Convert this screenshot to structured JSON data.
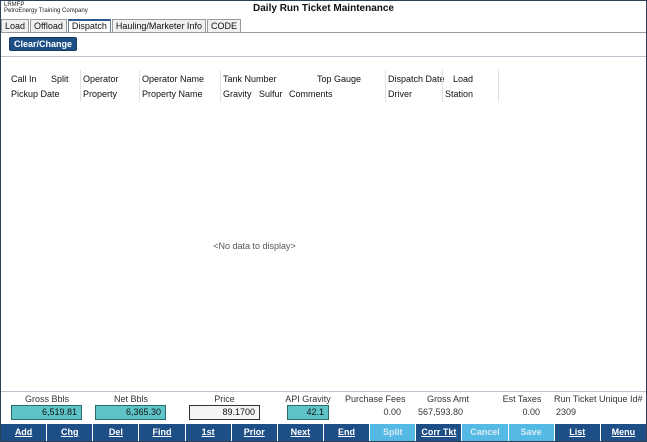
{
  "header": {
    "app_code": "LRMFP",
    "company": "PetroEnergy Training Company",
    "title": "Daily Run Ticket Maintenance"
  },
  "tabs": [
    {
      "label": "Load",
      "active": false
    },
    {
      "label": "Offload",
      "active": false
    },
    {
      "label": "Dispatch",
      "active": true
    },
    {
      "label": "Hauling/Marketer Info",
      "active": false
    },
    {
      "label": "CODE",
      "active": false
    }
  ],
  "toolbar": {
    "clear_change_label": "Clear/Change"
  },
  "grid": {
    "row1": [
      "Call In",
      "Split",
      "Operator",
      "Operator Name",
      "Tank Number",
      "Top Gauge",
      "Dispatch Date",
      "Load"
    ],
    "row2": [
      "Pickup Date",
      "Property",
      "Property Name",
      "Gravity",
      "Sulfur",
      "Comments",
      "Driver",
      "Station"
    ],
    "empty_message": "<No data to display>"
  },
  "totals": {
    "gross_bbls": {
      "label": "Gross Bbls",
      "value": "6,519.81"
    },
    "net_bbls": {
      "label": "Net Bbls",
      "value": "6,365.30"
    },
    "price": {
      "label": "Price",
      "value": "89.1700"
    },
    "api_gravity": {
      "label": "API Gravity",
      "value": "42.1"
    },
    "purchase_fees": {
      "label": "Purchase Fees",
      "value": "0.00"
    },
    "gross_amt": {
      "label": "Gross Amt",
      "value": "567,593.80"
    },
    "est_taxes": {
      "label": "Est Taxes",
      "value": "0.00"
    },
    "run_ticket_id": {
      "label": "Run Ticket Unique Id#",
      "value": "2309"
    }
  },
  "buttons": [
    {
      "label": "Add",
      "enabled": true
    },
    {
      "label": "Chg",
      "enabled": true
    },
    {
      "label": "Del",
      "enabled": true
    },
    {
      "label": "Find",
      "enabled": true
    },
    {
      "label": "1st",
      "enabled": true
    },
    {
      "label": "Prior",
      "enabled": true
    },
    {
      "label": "Next",
      "enabled": true
    },
    {
      "label": "End",
      "enabled": true
    },
    {
      "label": "Split",
      "enabled": false
    },
    {
      "label": "Corr Tkt",
      "enabled": true
    },
    {
      "label": "Cancel",
      "enabled": false
    },
    {
      "label": "Save",
      "enabled": false
    },
    {
      "label": "List",
      "enabled": true
    },
    {
      "label": "Menu",
      "enabled": true
    }
  ],
  "colors": {
    "button_blue": "#1d4e85",
    "button_disabled": "#55b9e6",
    "teal_field": "#5fc4c8"
  }
}
